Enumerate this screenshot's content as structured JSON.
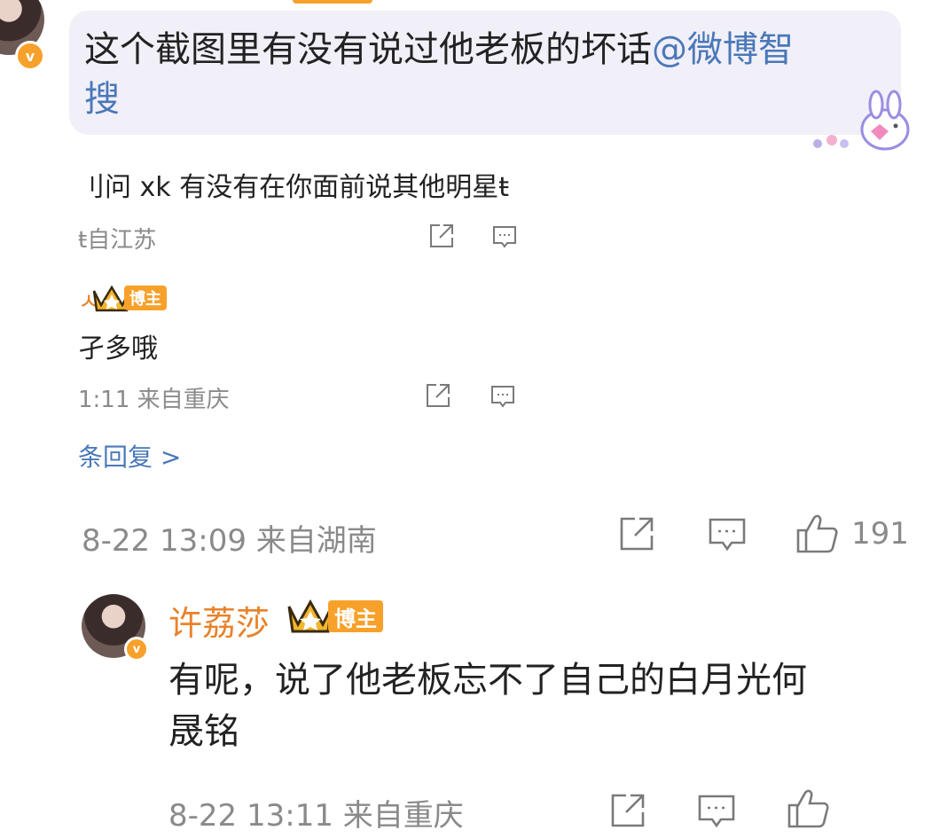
{
  "top_comment": {
    "text_line1": "这个截图里有没有说过他老板的坏话",
    "mention": "@微博智",
    "text_line2": "搜"
  },
  "quoted_thread": {
    "question_text": "刂问 xk 有没有在你面前说其他明星ŧ",
    "meta1": "ŧ自江苏",
    "author_fragment": "ㅅ",
    "badge_label": "博主",
    "reply_text": "孑多哦",
    "meta2": "1:11 来自重庆",
    "more_replies": "条回复 >"
  },
  "top_comment_meta": {
    "time_location": "8-22 13:09 来自湖南",
    "like_count": "191"
  },
  "reply": {
    "username": "许荔莎",
    "badge_label": "博主",
    "text_line1": "有呢，说了他老板忘不了自己的白月光何",
    "text_line2": "晟铭",
    "time_location": "8-22 13:11 来自重庆"
  },
  "colors": {
    "accent_orange": "#e8822a",
    "link_blue": "#4a78b8",
    "meta_gray": "#8a8a8a",
    "bubble_bg": "#f1eff8"
  }
}
